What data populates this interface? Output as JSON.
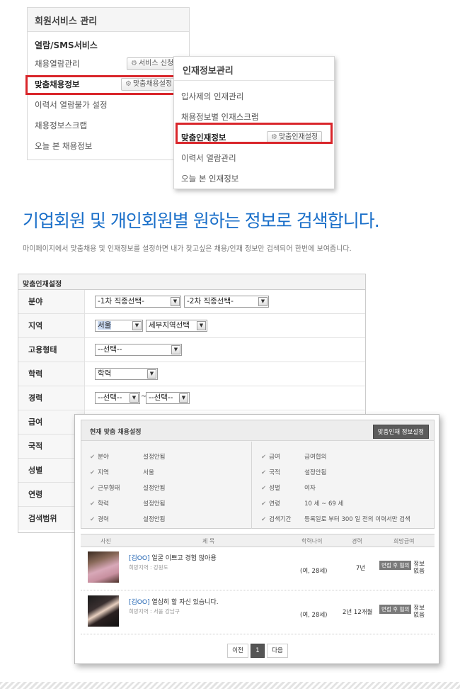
{
  "service_panel": {
    "title": "회원서비스 관리",
    "section": "열람/SMS서비스",
    "items": [
      {
        "label": "채용열람관리",
        "button": "서비스 신청"
      },
      {
        "label": "맞춤채용정보",
        "button": "맞춤채용설정"
      },
      {
        "label": "이력서 열람불가 설정"
      },
      {
        "label": "채용정보스크랩"
      },
      {
        "label": "오늘 본 채용정보"
      }
    ]
  },
  "hr_panel": {
    "title": "인재정보관리",
    "items": [
      {
        "label": "입사제의 인재관리"
      },
      {
        "label": "채용정보별 인재스크랩"
      },
      {
        "label": "맞춤인재정보",
        "button": "맞춤인재설정"
      },
      {
        "label": "이력서 열람관리"
      },
      {
        "label": "오늘 본 인재정보"
      }
    ]
  },
  "headline": "기업회원 및 개인회원별 원하는 정보로 검색합니다.",
  "description": "마이페이지에서 맞춤채용 및 인재정보를 설정하면 내가 찾고싶은 채용/인재 정보만 검색되어 한번에 보여줍니다.",
  "form": {
    "title": "맞춤인재설정",
    "rows": {
      "field": {
        "label": "분야",
        "sel1": "-1차 직종선택-",
        "sel2": "-2차 직종선택-"
      },
      "region": {
        "label": "지역",
        "sel1": "서울",
        "sel2": "세부지역선택"
      },
      "employment": {
        "label": "고용형태",
        "sel1": "--선택--"
      },
      "education": {
        "label": "학력",
        "sel1": "학력"
      },
      "career": {
        "label": "경력",
        "sel1": "--선택--",
        "sep": "~",
        "sel2": "--선택--"
      },
      "salary": {
        "label": "급여"
      },
      "nationality": {
        "label": "국적"
      },
      "gender": {
        "label": "성별"
      },
      "age": {
        "label": "연령"
      },
      "scope": {
        "label": "검색범위"
      }
    }
  },
  "popup": {
    "title": "현재 맞춤 채용설정",
    "button": "맞춤인재 정보설정",
    "left": [
      {
        "k": "분야",
        "v": "설정안됨"
      },
      {
        "k": "지역",
        "v": "서울"
      },
      {
        "k": "근무형태",
        "v": "설정안됨"
      },
      {
        "k": "학력",
        "v": "설정안됨"
      },
      {
        "k": "경력",
        "v": "설정안됨"
      }
    ],
    "right": [
      {
        "k": "급여",
        "v": "급여협의"
      },
      {
        "k": "국적",
        "v": "설정안됨"
      },
      {
        "k": "성별",
        "v": "여자"
      },
      {
        "k": "연령",
        "v": "10 세 ~ 69 세"
      },
      {
        "k": "검색기간",
        "v": "등록일로 부터 300 일 전의 이력서만 검색"
      }
    ],
    "columns": [
      "사진",
      "제 목",
      "학력나이",
      "경력",
      "희망급여"
    ],
    "results": [
      {
        "name": "[김OO]",
        "title": "얼굴 이쁘고 경험 많아용",
        "loc": "희망지역 : 강원도",
        "gender_age": "(여, 28세)",
        "career": "7년",
        "badge": "면접 후 협의",
        "extra": "정보 없음"
      },
      {
        "name": "[김OO]",
        "title": "열심히 할 자신 있습니다.",
        "loc": "희망지역 : 서울 강남구",
        "gender_age": "(여, 28세)",
        "career": "2년 12개월",
        "badge": "면접 후 협의",
        "extra": "정보 없음"
      }
    ],
    "pagination": {
      "prev": "이전",
      "current": "1",
      "next": "다음"
    }
  },
  "colors": {
    "accent_blue": "#1a6fc9",
    "highlight_red": "#d9262b"
  }
}
